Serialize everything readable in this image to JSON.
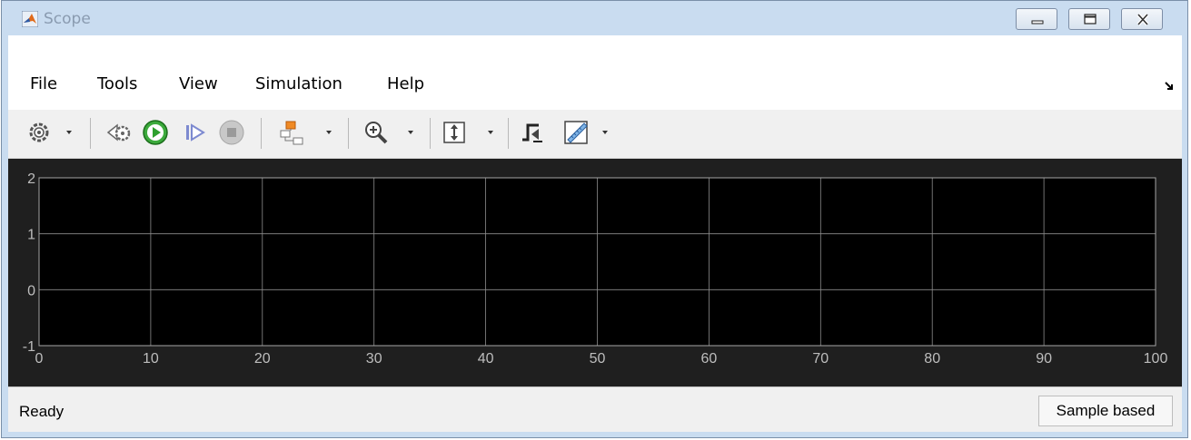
{
  "window": {
    "title": "Scope",
    "controls": [
      "minimize-icon",
      "maximize-icon",
      "close-icon"
    ]
  },
  "menu": {
    "items": [
      {
        "label": "File"
      },
      {
        "label": "Tools"
      },
      {
        "label": "View"
      },
      {
        "label": "Simulation"
      },
      {
        "label": "Help"
      }
    ],
    "undock_icon": "dock-arrow-icon"
  },
  "toolbar": {
    "buttons": [
      {
        "icon": "settings-icon",
        "has_dropdown": true
      },
      {
        "icon": "step-back-icon"
      },
      {
        "icon": "run-icon",
        "color": "#2ea02e"
      },
      {
        "icon": "step-forward-icon"
      },
      {
        "icon": "stop-icon"
      },
      {
        "icon": "signal-select-icon",
        "has_dropdown": true
      },
      {
        "icon": "zoom-in-icon",
        "has_dropdown": true
      },
      {
        "icon": "scale-axes-icon",
        "has_dropdown": true
      },
      {
        "icon": "triggers-icon"
      },
      {
        "icon": "measurements-icon",
        "has_dropdown": true
      }
    ]
  },
  "chart_data": {
    "type": "line",
    "title": "",
    "xlabel": "",
    "ylabel": "",
    "xlim": [
      0,
      100
    ],
    "ylim": [
      -1,
      2
    ],
    "xticks": [
      "0",
      "10",
      "20",
      "30",
      "40",
      "50",
      "60",
      "70",
      "80",
      "90",
      "100"
    ],
    "yticks": [
      "2",
      "1",
      "0",
      "-1"
    ],
    "grid": true,
    "background": "#000000",
    "series": []
  },
  "status": {
    "text": "Ready",
    "mode": "Sample based"
  }
}
